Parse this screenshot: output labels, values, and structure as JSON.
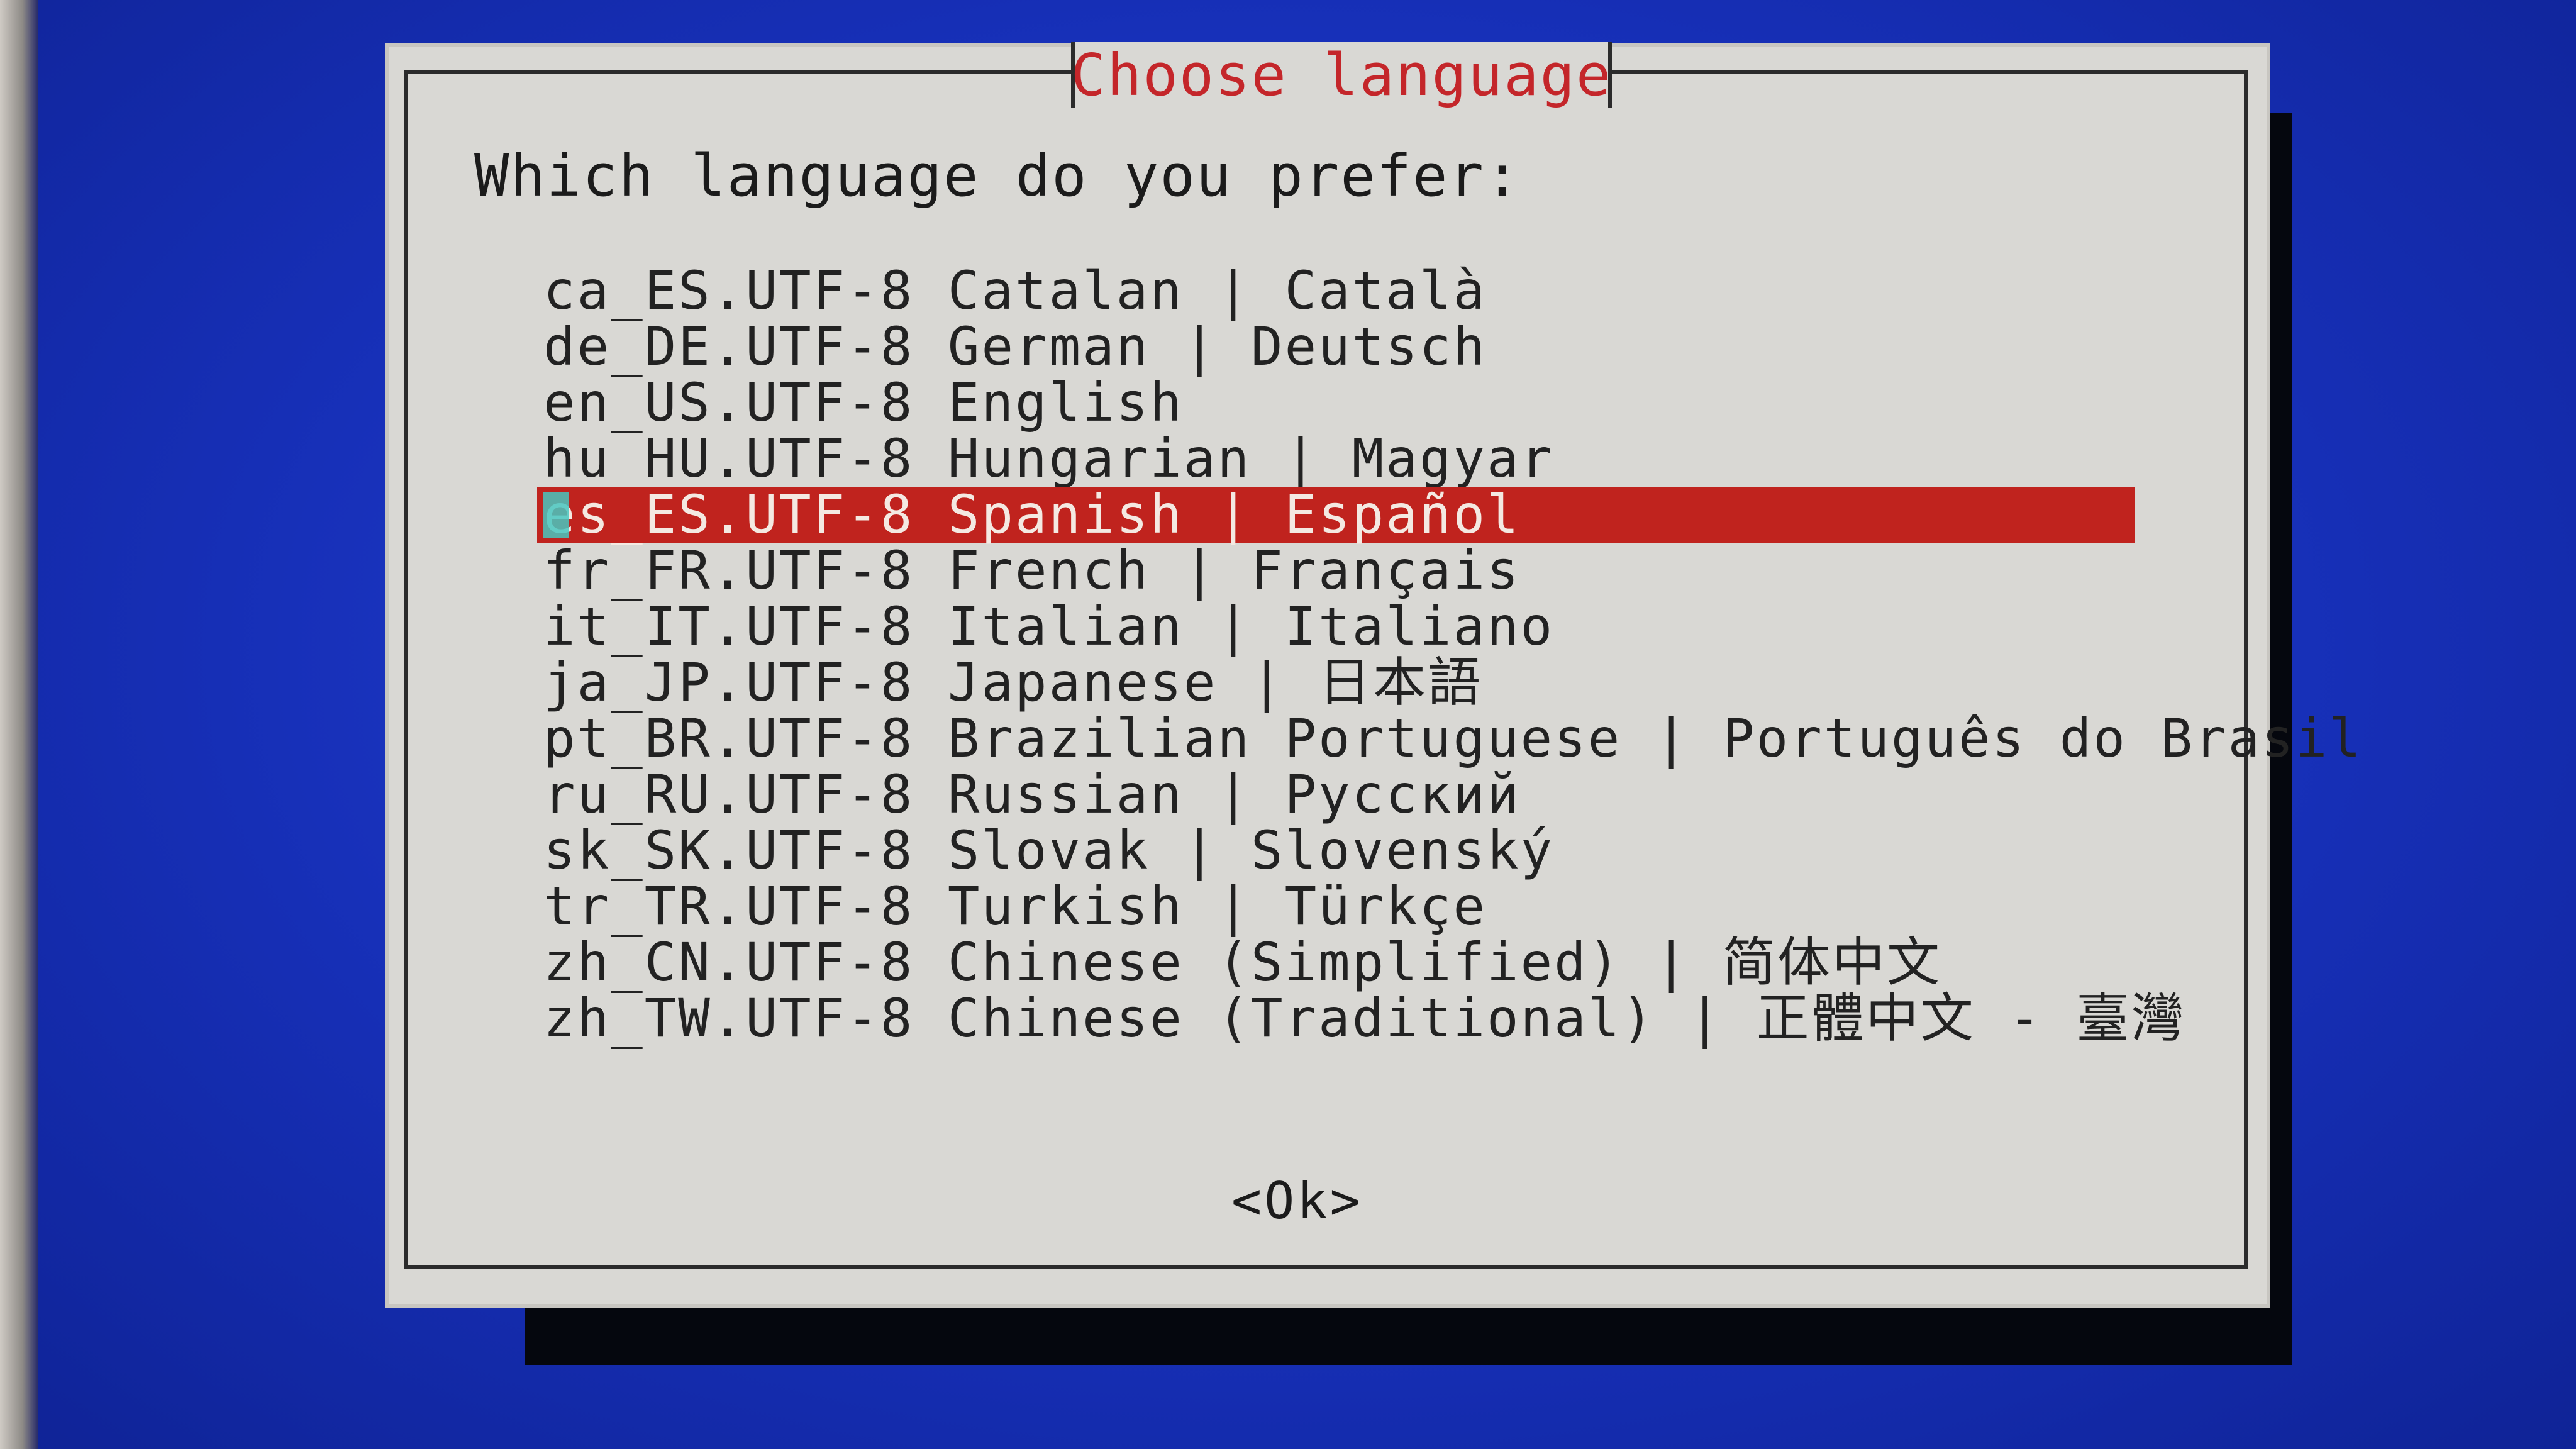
{
  "dialog": {
    "title": "Choose language",
    "prompt": "Which language do you prefer:",
    "selected_index": 4,
    "ok_label": "<Ok>"
  },
  "languages": [
    "ca_ES.UTF-8 Catalan | Català",
    "de_DE.UTF-8 German | Deutsch",
    "en_US.UTF-8 English",
    "hu_HU.UTF-8 Hungarian | Magyar",
    "es_ES.UTF-8 Spanish | Español",
    "fr_FR.UTF-8 French | Français",
    "it_IT.UTF-8 Italian | Italiano",
    "ja_JP.UTF-8 Japanese | 日本語",
    "pt_BR.UTF-8 Brazilian Portuguese | Português do Brasil",
    "ru_RU.UTF-8 Russian | Русский",
    "sk_SK.UTF-8 Slovak | Slovenský",
    "tr_TR.UTF-8 Turkish | Türkçe",
    "zh_CN.UTF-8 Chinese (Simplified) | 简体中文",
    "zh_TW.UTF-8 Chinese (Traditional) | 正體中文 - 臺灣"
  ],
  "colors": {
    "background": "#1a2fb8",
    "dialog": "#d9d8d4",
    "title": "#c4262a",
    "selection": "#c0231e",
    "cursor": "#48c7c0"
  }
}
